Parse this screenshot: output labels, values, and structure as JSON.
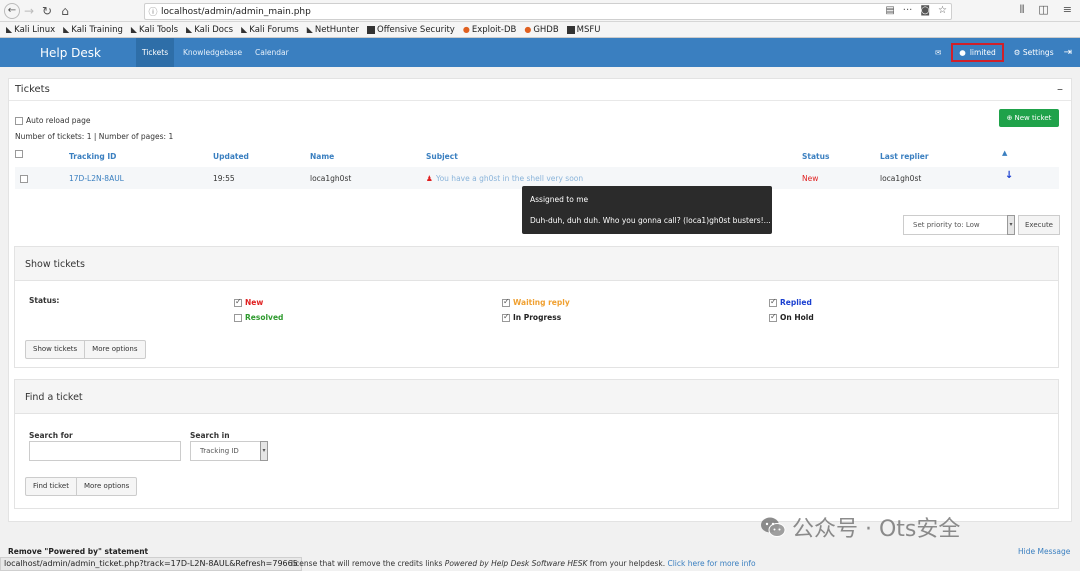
{
  "browser": {
    "url": "localhost/admin/admin_main.php",
    "bookmarks": [
      "Kali Linux",
      "Kali Training",
      "Kali Tools",
      "Kali Docs",
      "Kali Forums",
      "NetHunter",
      "Offensive Security",
      "Exploit-DB",
      "GHDB",
      "MSFU"
    ]
  },
  "header": {
    "brand": "Help Desk",
    "tabs": [
      "Tickets",
      "Knowledgebase",
      "Calendar"
    ],
    "user": "limited",
    "settings": "Settings"
  },
  "tickets_panel": {
    "title": "Tickets",
    "auto_reload": "Auto reload page",
    "new_ticket": "New ticket",
    "counts": "Number of tickets: 1 | Number of pages: 1",
    "columns": [
      "Tracking ID",
      "Updated",
      "Name",
      "Subject",
      "Status",
      "Last replier"
    ],
    "rows": [
      {
        "id": "17D-L2N-8AUL",
        "updated": "19:55",
        "name": "loca1gh0st",
        "subject": "You have a gh0st in the shell very soon",
        "status": "New",
        "last_replier": "loca1gh0st"
      }
    ],
    "tooltip": {
      "line1": "Assigned to me",
      "line2": "Duh-duh, duh duh. Who you gonna call? (loca1)gh0st busters!..."
    },
    "priority": "Set priority to: Low",
    "execute": "Execute"
  },
  "show_tickets": {
    "title": "Show tickets",
    "status_label": "Status:",
    "statuses": [
      {
        "label": "New",
        "checked": true
      },
      {
        "label": "Waiting reply",
        "checked": true
      },
      {
        "label": "Replied",
        "checked": true
      },
      {
        "label": "Resolved",
        "checked": false
      },
      {
        "label": "In Progress",
        "checked": true
      },
      {
        "label": "On Hold",
        "checked": true
      }
    ],
    "buttons": [
      "Show tickets",
      "More options"
    ]
  },
  "find_ticket": {
    "title": "Find a ticket",
    "search_for": "Search for",
    "search_in": "Search in",
    "search_in_value": "Tracking ID",
    "buttons": [
      "Find ticket",
      "More options"
    ]
  },
  "footer": {
    "remove_powered": "Remove \"Powered by\" statement",
    "hide": "Hide Message",
    "status_url": "localhost/admin/admin_ticket.php?track=17D-L2N-8AUL&Refresh=79665",
    "license_a": "license that will remove the credits links ",
    "license_b": "Powered by Help Desk Software HESK",
    "license_c": " from your helpdesk. ",
    "license_link": "Click here for more info"
  },
  "watermark": "公众号 · Ots安全"
}
